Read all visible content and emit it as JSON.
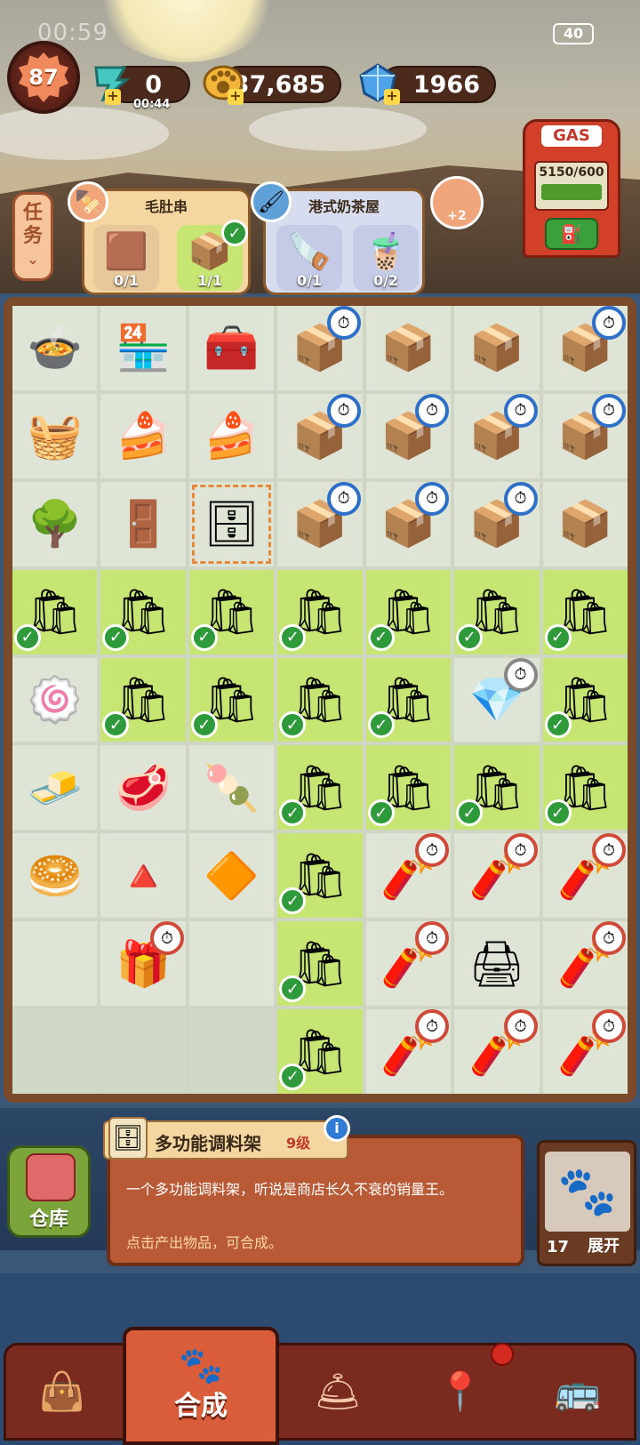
{
  "status_bar": {
    "time": "00:59",
    "battery": "40"
  },
  "header": {
    "level": "87",
    "energy": {
      "value": "0",
      "timer": "00:44",
      "icon": "lightning-icon"
    },
    "coins": {
      "value": "37,685",
      "icon": "paw-coin-icon"
    },
    "gems": {
      "value": "1966",
      "icon": "gem-icon"
    }
  },
  "gas_pump": {
    "label": "GAS",
    "value": "5150/600"
  },
  "task_tab": {
    "label": "任务",
    "icon": "chevron-down-icon"
  },
  "orders": [
    {
      "title": "毛肚串",
      "items": [
        {
          "icon": "dried-seaweed-icon",
          "count": "0/1"
        },
        {
          "icon": "takeout-box-icon",
          "count": "1/1",
          "done": true
        }
      ]
    },
    {
      "title": "港式奶茶屋",
      "items": [
        {
          "icon": "saw-icon",
          "count": "0/1"
        },
        {
          "icon": "milk-tea-icon",
          "count": "0/2"
        }
      ]
    }
  ],
  "bonus": {
    "label": "+2"
  },
  "info": {
    "name": "多功能调料架",
    "level": "9级",
    "description": "一个多功能调料架，听说是商店长久不衰的销量王。",
    "hint": "点击产出物品，可合成。"
  },
  "warehouse": {
    "label": "仓库"
  },
  "expand": {
    "count": "17",
    "label": "展开"
  },
  "nav": {
    "active_label": "合成",
    "items": [
      "bag-icon",
      "merge-icon",
      "service-bell-icon",
      "map-pin-icon",
      "bus-icon"
    ]
  }
}
